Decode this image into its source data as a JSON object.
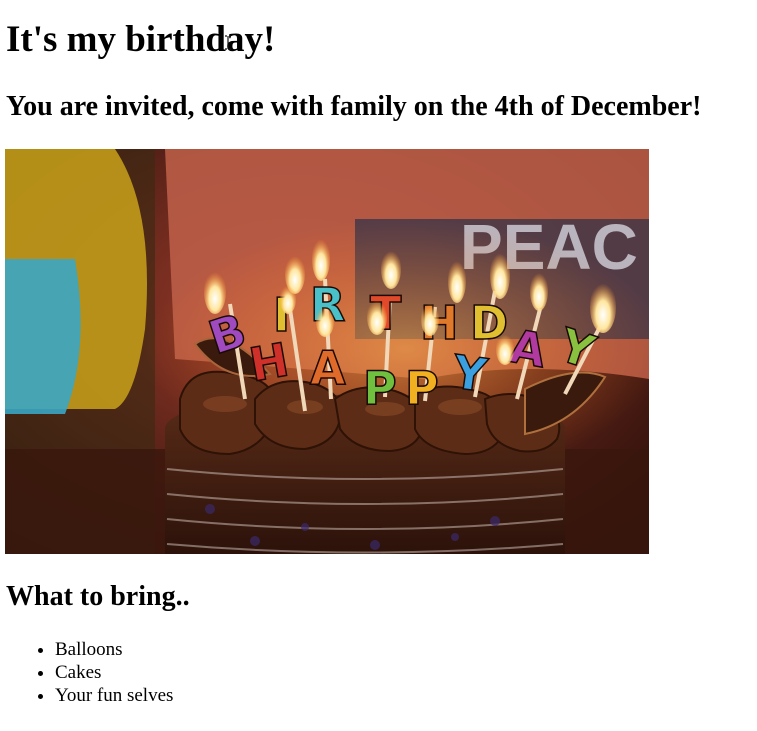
{
  "page": {
    "heading": "It's my birthday!",
    "subheading": "You are invited, come with family on the 4th of December!",
    "bring_heading": "What to bring..",
    "bring_items": [
      "Balloons",
      "Cakes",
      "Your fun selves"
    ]
  },
  "photo": {
    "alt": "Chocolate birthday cake with glittery HAPPY BIRTHDAY letter candles",
    "candle_letters": [
      "B",
      "I",
      "R",
      "T",
      "H",
      "D",
      "A",
      "Y",
      "H",
      "A",
      "P",
      "P",
      "Y"
    ],
    "background_shirt_text": "PEAC"
  },
  "colors": {
    "text": "#000000",
    "background": "#ffffff",
    "chocolate": "#4a2414",
    "shirt": "#c0604a",
    "flame": "#ffd37a"
  }
}
